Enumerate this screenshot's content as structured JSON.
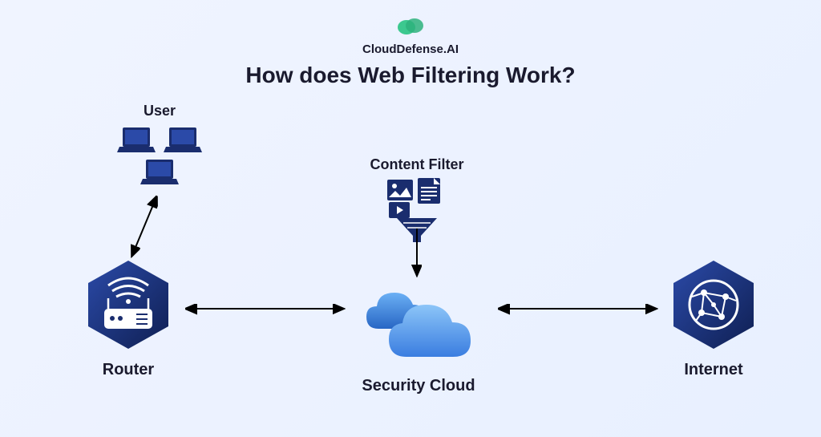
{
  "brand": {
    "name": "CloudDefense.AI",
    "logo_color_1": "#3cc88f",
    "logo_color_2": "#2db17c"
  },
  "diagram": {
    "title": "How does Web Filtering Work?",
    "nodes": {
      "user": {
        "label": "User"
      },
      "content_filter": {
        "label": "Content Filter"
      },
      "router": {
        "label": "Router"
      },
      "security_cloud": {
        "label": "Security Cloud"
      },
      "internet": {
        "label": "Internet"
      }
    },
    "connections": [
      {
        "from": "user",
        "to": "router",
        "bidirectional": true
      },
      {
        "from": "router",
        "to": "security_cloud",
        "bidirectional": true
      },
      {
        "from": "content_filter",
        "to": "security_cloud",
        "bidirectional": false
      },
      {
        "from": "security_cloud",
        "to": "internet",
        "bidirectional": true
      }
    ],
    "colors": {
      "dark_blue": "#1a2d6e",
      "mid_blue": "#2b4aa8",
      "light_blue": "#4a8ce8"
    }
  }
}
